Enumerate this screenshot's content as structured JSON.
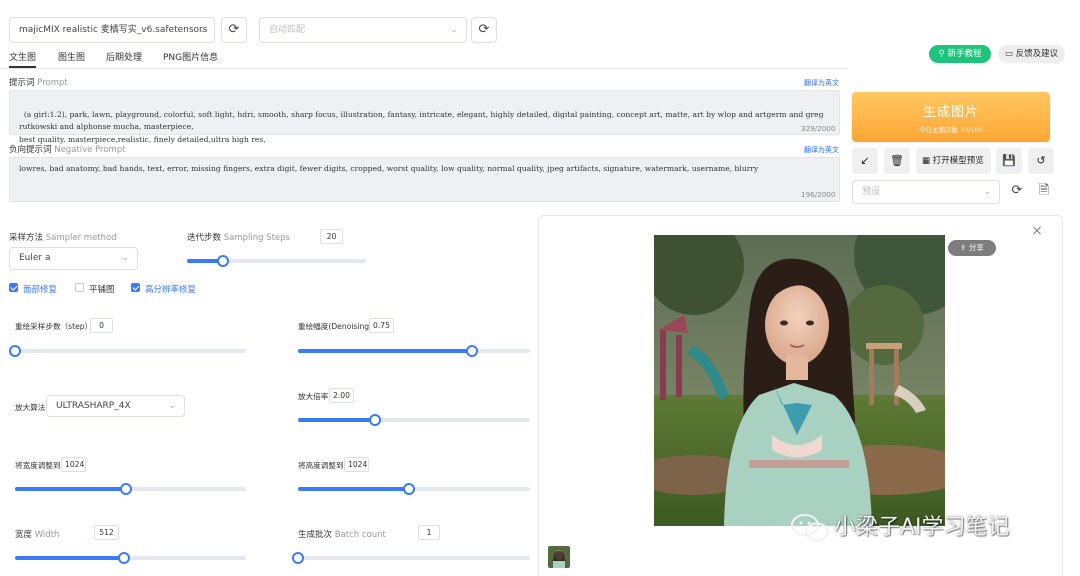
{
  "top": {
    "model_select": "majicMIX realistic 麦橘写实_v6.safetensors",
    "vae_select_placeholder": "自动匹配"
  },
  "tabs": [
    "文生图",
    "图生图",
    "后期处理",
    "PNG图片信息"
  ],
  "header_buttons": {
    "tutorial": "新手教程",
    "feedback": "反馈及建议"
  },
  "prompt": {
    "label_cn": "提示词",
    "label_en": "Prompt",
    "translate": "翻译为英文",
    "text": "(a girl:1.2), park, lawn, playground, colorful, soft light, hdri, smooth, sharp focus, illustration, fantasy, intricate, elegant, highly detailed, digital painting, concept art, matte, art by wlop and artgerm and greg rutkowski and alphonse mucha, masterpiece,\nbest quality, masterpiece,realistic, finely detailed,ultra high res,",
    "counter": "329/2000"
  },
  "negative_prompt": {
    "label_cn": "负向提示词",
    "label_en": "Negative Prompt",
    "translate": "翻译为英文",
    "text": "lowres, bad anatomy, bad hands, text, error, missing fingers, extra digit, fewer digits, cropped, worst quality, low quality, normal quality, jpeg artifacts, signature, watermark, username, blurry",
    "counter": "196/2000"
  },
  "generate": {
    "title": "生成图片",
    "subtitle": "今日生图次数 33/100"
  },
  "actions": {
    "open_preview": "打开模型预览",
    "preset_placeholder": "预设"
  },
  "sampler": {
    "label_cn": "采样方法",
    "label_en": "Sampler method",
    "value": "Euler a"
  },
  "steps": {
    "label_cn": "迭代步数",
    "label_en": "Sampling Steps",
    "value": "20",
    "level": 0.2
  },
  "checkboxes": [
    {
      "label": "面部修复",
      "checked": true
    },
    {
      "label": "平铺图",
      "checked": false
    },
    {
      "label": "高分辨率修复",
      "checked": true
    }
  ],
  "hires": {
    "resample_steps": {
      "label": "重绘采样步数（step）",
      "value": "0",
      "level": 0.0
    },
    "denoising": {
      "label": "重绘幅度(Denoising)",
      "value": "0.75",
      "level": 0.75
    },
    "upscaler": {
      "label": "放大算法",
      "value": "ULTRASHARP_4X"
    },
    "upscale_by": {
      "label": "放大倍率",
      "value": "2.00",
      "level": 0.33
    },
    "resize_width": {
      "label": "将宽度调整到",
      "value": "1024",
      "level": 0.48
    },
    "resize_height": {
      "label": "将高度调整到",
      "value": "1024",
      "level": 0.48
    }
  },
  "width": {
    "label_cn": "宽度",
    "label_en": "Width",
    "value": "512",
    "level": 0.47
  },
  "batch": {
    "label_cn": "生成批次",
    "label_en": "Batch count",
    "value": "1",
    "level": 0.0
  },
  "output": {
    "share": "分享"
  },
  "watermark": "小梁子AI学习笔记",
  "colors": {
    "accent": "#3a7af7",
    "generate": "#fda535",
    "tutorial": "#1fc47c"
  }
}
